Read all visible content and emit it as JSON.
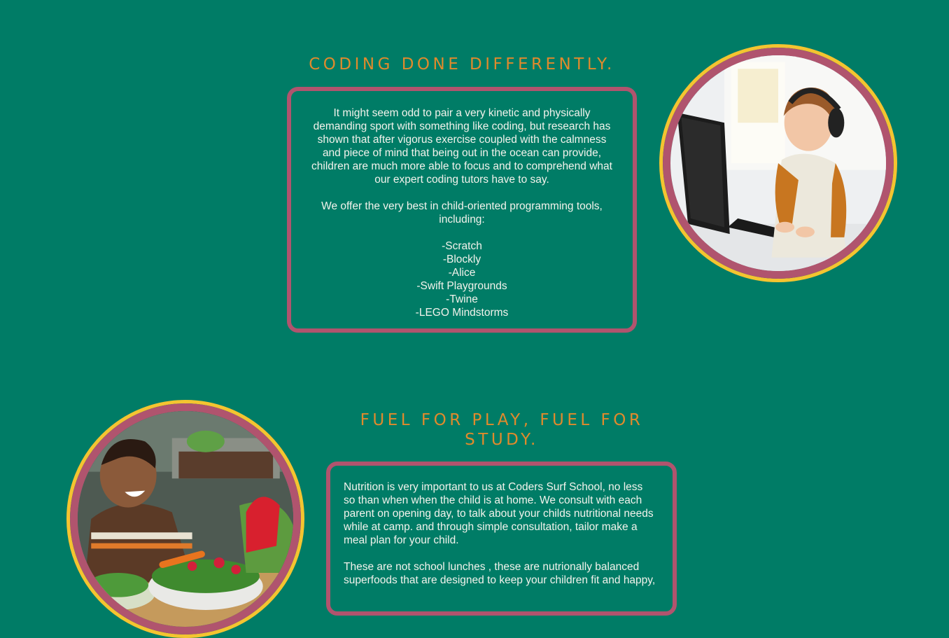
{
  "coding": {
    "heading": "CODING DONE DIFFERENTLY.",
    "paragraph": "It might seem odd to pair a very kinetic and physically demanding sport with something like coding, but research has shown that after vigorus exercise coupled with the calmness and piece of mind that being out in the ocean can provide, children are much more able to focus and to comprehend what our expert coding tutors have to say.",
    "tools_intro": "We offer the very best in child-oriented programming tools, including:",
    "tools": [
      "-Scratch",
      "-Blockly",
      "-Alice",
      "-Swift Playgrounds",
      "-Twine",
      "-LEGO Mindstorms"
    ],
    "image_alt": "boy-with-headphones-at-computer"
  },
  "nutrition": {
    "heading": "FUEL FOR PLAY, FUEL FOR STUDY.",
    "paragraph_1": "Nutrition is very important to us at Coders Surf School, no less so than when when the child is at home. We consult with each parent on opening day, to talk about your childs nutritional needs while at camp. and through simple consultation, tailor make a meal plan for your child.",
    "paragraph_2": "These are not school lunches , these are nutrionally balanced superfoods that are designed to keep your children fit and happy,",
    "image_alt": "child-eating-vegetables"
  },
  "colors": {
    "background": "#007c66",
    "heading": "#e08a2c",
    "card_border": "#b0546e",
    "ring_outer": "#f4c430",
    "ring_inner": "#b0546e"
  }
}
